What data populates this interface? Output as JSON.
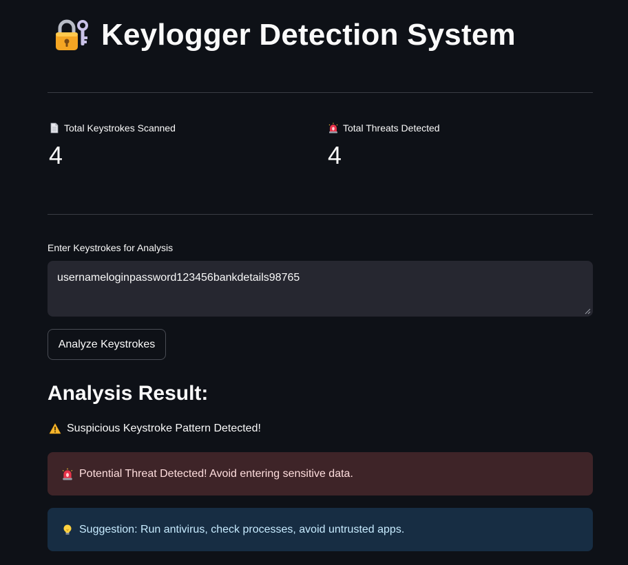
{
  "header": {
    "title": "Keylogger Detection System",
    "icon": "lock-with-key-icon"
  },
  "metrics": [
    {
      "icon": "page-icon",
      "label": "Total Keystrokes Scanned",
      "value": "4"
    },
    {
      "icon": "siren-icon",
      "label": "Total Threats Detected",
      "value": "4"
    }
  ],
  "input": {
    "label": "Enter Keystrokes for Analysis",
    "value": "usernameloginpassword123456bankdetails98765"
  },
  "button": {
    "label": "Analyze Keystrokes"
  },
  "result": {
    "heading": "Analysis Result:",
    "warning": {
      "icon": "warning-icon",
      "text": "Suspicious Keystroke Pattern Detected!"
    },
    "error": {
      "icon": "siren-icon",
      "text": "Potential Threat Detected! Avoid entering sensitive data."
    },
    "info": {
      "icon": "lightbulb-icon",
      "text": "Suggestion: Run antivirus, check processes, avoid untrusted apps."
    }
  },
  "colors": {
    "background": "#0e1117",
    "error_bg": "#3e2428",
    "info_bg": "#172d43",
    "input_bg": "#262730"
  }
}
